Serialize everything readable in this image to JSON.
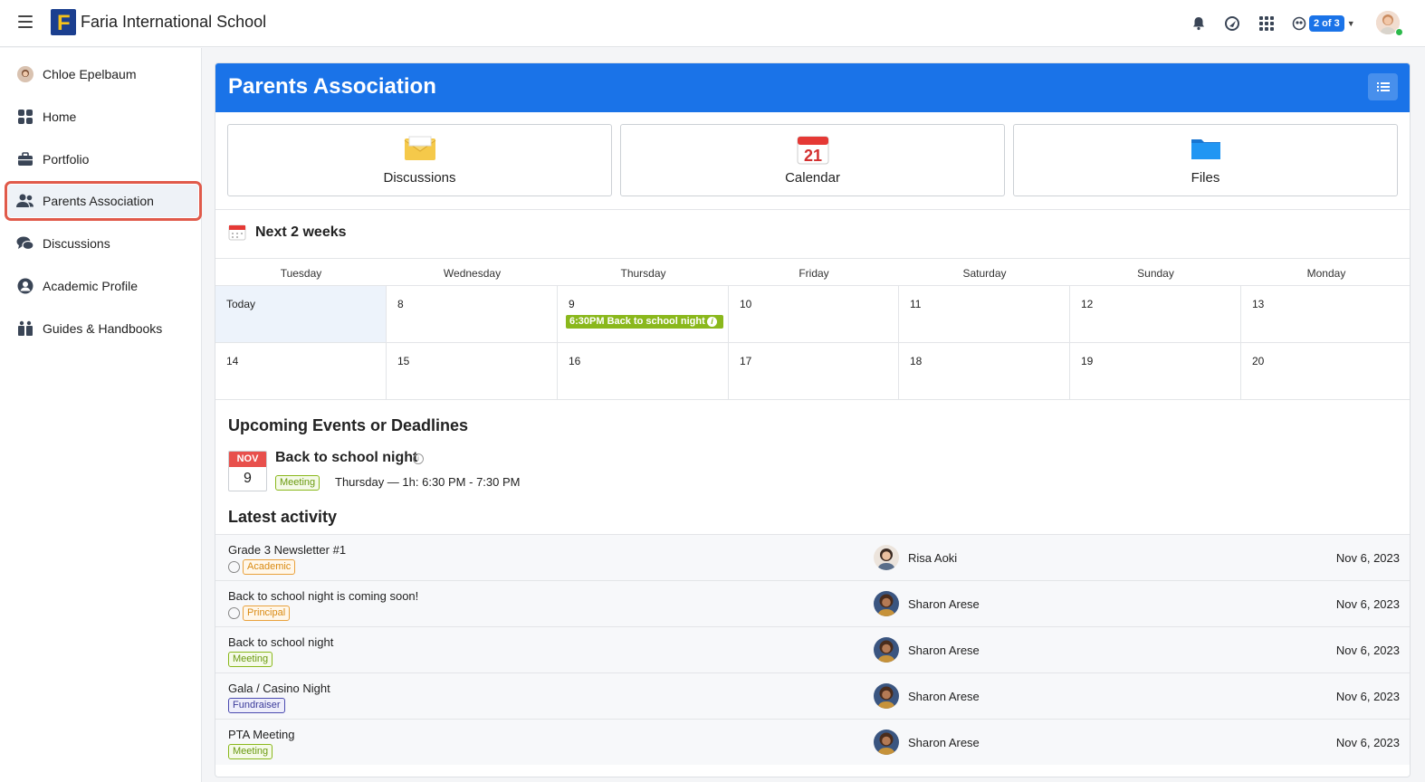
{
  "topbar": {
    "school_name": "Faria International School",
    "logo_letter": "F",
    "icons": [
      "menu-icon",
      "bell-icon",
      "messages-icon",
      "apps-grid-icon",
      "globe-icon"
    ],
    "switcher_badge": "2 of 3"
  },
  "sidebar": {
    "items": [
      {
        "label": "Chloe Epelbaum",
        "icon": "user-avatar"
      },
      {
        "label": "Home",
        "icon": "grid-icon"
      },
      {
        "label": "Portfolio",
        "icon": "briefcase-icon"
      },
      {
        "label": "Parents Association",
        "icon": "users-icon",
        "active": true
      },
      {
        "label": "Discussions",
        "icon": "chat-bubbles-icon"
      },
      {
        "label": "Academic Profile",
        "icon": "person-circle-icon"
      },
      {
        "label": "Guides & Handbooks",
        "icon": "books-icon"
      }
    ]
  },
  "main": {
    "title": "Parents Association",
    "tiles": [
      {
        "label": "Discussions",
        "icon": "envelope-icon"
      },
      {
        "label": "Calendar",
        "icon": "calendar-21-icon",
        "icon_number": "21"
      },
      {
        "label": "Files",
        "icon": "folder-icon"
      }
    ],
    "next_weeks_title": "Next 2 weeks",
    "calendar": {
      "days": [
        "Tuesday",
        "Wednesday",
        "Thursday",
        "Friday",
        "Saturday",
        "Sunday",
        "Monday"
      ],
      "week1": [
        "Today",
        "8",
        "9",
        "10",
        "11",
        "12",
        "13"
      ],
      "week2": [
        "14",
        "15",
        "16",
        "17",
        "18",
        "19",
        "20"
      ],
      "event_chip": "6:30PM Back to school night"
    },
    "upcoming": {
      "title": "Upcoming Events or Deadlines",
      "month": "NOV",
      "day": "9",
      "event_title": "Back to school night",
      "tag": "Meeting",
      "when": "Thursday — 1h: 6:30 PM - 7:30 PM"
    },
    "activity": {
      "title": "Latest activity",
      "rows": [
        {
          "title": "Grade 3 Newsletter #1",
          "tag": "Academic",
          "tag_class": "academic",
          "chat": true,
          "author": "Risa Aoki",
          "date": "Nov 6, 2023"
        },
        {
          "title": "Back to school night is coming soon!",
          "tag": "Principal",
          "tag_class": "principal",
          "chat": true,
          "author": "Sharon Arese",
          "date": "Nov 6, 2023"
        },
        {
          "title": "Back to school night",
          "tag": "Meeting",
          "tag_class": "meeting",
          "chat": false,
          "author": "Sharon Arese",
          "date": "Nov 6, 2023"
        },
        {
          "title": "Gala / Casino Night",
          "tag": "Fundraiser",
          "tag_class": "fundraiser",
          "chat": false,
          "author": "Sharon Arese",
          "date": "Nov 6, 2023"
        },
        {
          "title": "PTA Meeting",
          "tag": "Meeting",
          "tag_class": "meeting",
          "chat": false,
          "author": "Sharon Arese",
          "date": "Nov 6, 2023"
        }
      ]
    }
  },
  "colors": {
    "brand_blue": "#1a73e8",
    "active_outline": "#e05a4a",
    "meeting_green": "#8ab81c",
    "date_red": "#e8504c"
  }
}
